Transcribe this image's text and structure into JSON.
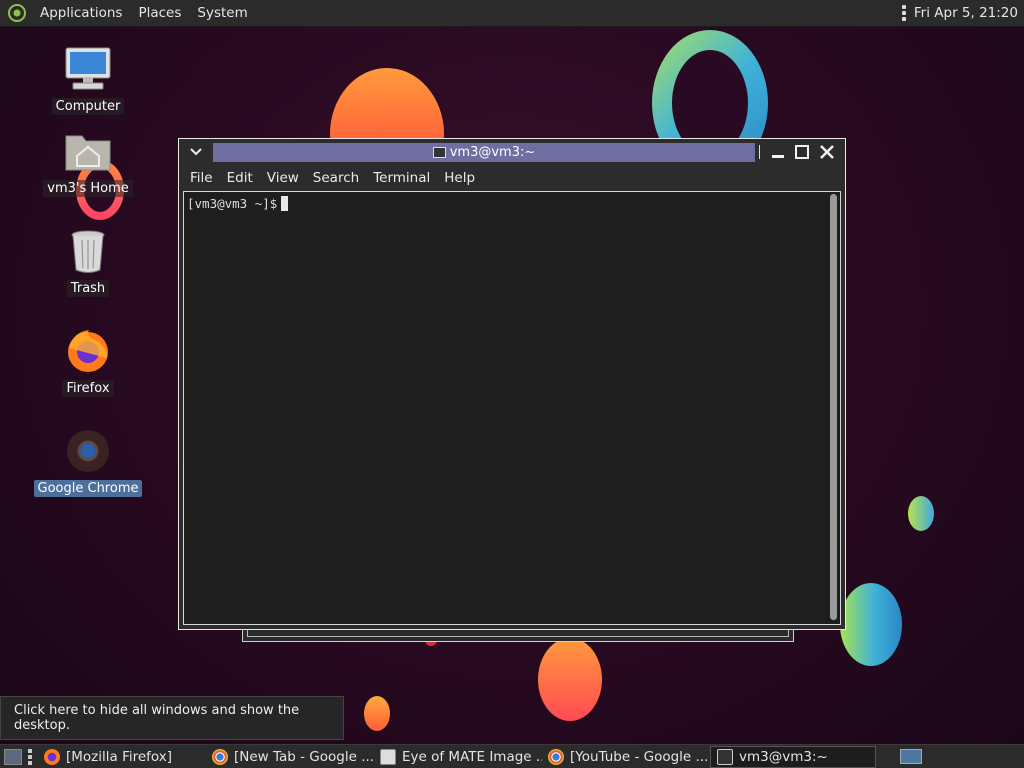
{
  "top_panel": {
    "menus": [
      "Applications",
      "Places",
      "System"
    ],
    "clock": "Fri Apr  5, 21:20"
  },
  "desktop_icons": [
    {
      "label": "Computer",
      "icon": "computer-icon"
    },
    {
      "label": "vm3's Home",
      "icon": "home-folder-icon"
    },
    {
      "label": "Trash",
      "icon": "trash-icon"
    },
    {
      "label": "Firefox",
      "icon": "firefox-icon"
    },
    {
      "label": "Google Chrome",
      "icon": "chrome-icon",
      "selected": true
    }
  ],
  "terminal": {
    "title": "vm3@vm3:~",
    "menus": [
      "File",
      "Edit",
      "View",
      "Search",
      "Terminal",
      "Help"
    ],
    "prompt": "[vm3@vm3 ~]$"
  },
  "tooltip": "Click here to hide all windows and show the desktop.",
  "taskbar": {
    "tasks": [
      {
        "label": "[Mozilla Firefox]",
        "icon": "firefox-icon"
      },
      {
        "label": "[New Tab - Google ...",
        "icon": "chrome-icon"
      },
      {
        "label": "Eye of MATE Image ...",
        "icon": "image-viewer-icon"
      },
      {
        "label": "[YouTube - Google ...",
        "icon": "chrome-icon"
      },
      {
        "label": "vm3@vm3:~",
        "icon": "terminal-icon",
        "active": true
      }
    ]
  },
  "colors": {
    "title_highlight": "#6e6ea0",
    "panel": "#2b2b2b",
    "terminal_bg": "#1e1e1e",
    "selection": "#4d6f9c"
  }
}
